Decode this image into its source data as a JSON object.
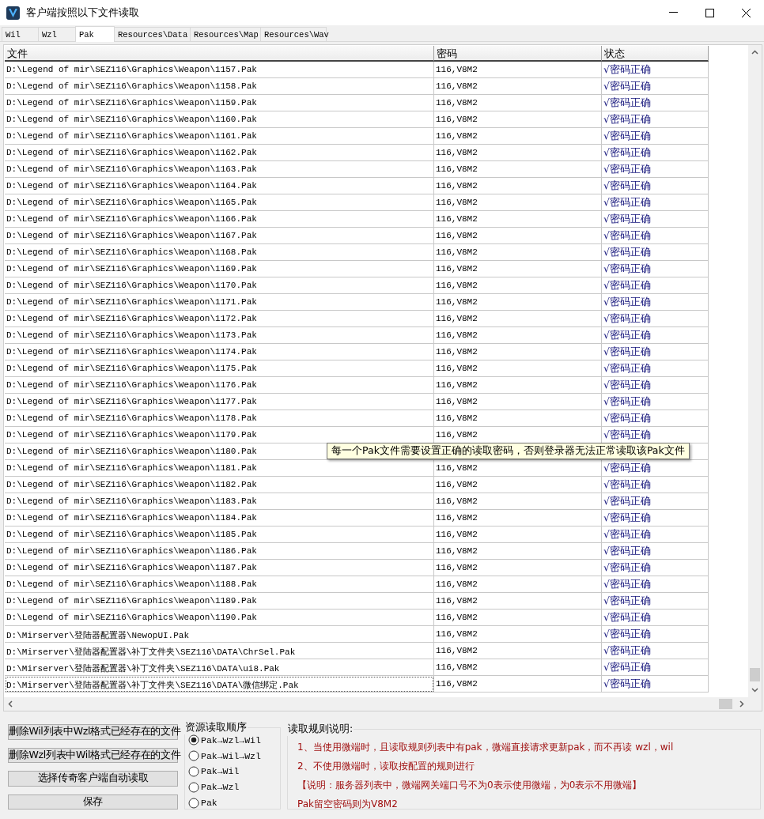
{
  "window": {
    "title": "客户端按照以下文件读取"
  },
  "tabs": [
    {
      "label": "Wil",
      "selected": false
    },
    {
      "label": "Wzl",
      "selected": false
    },
    {
      "label": "Pak",
      "selected": true
    },
    {
      "label": "Resources\\Data",
      "selected": false
    },
    {
      "label": "Resources\\Map",
      "selected": false
    },
    {
      "label": "Resources\\Wav",
      "selected": false
    }
  ],
  "table": {
    "columns": [
      "文件",
      "密码",
      "状态"
    ],
    "rows": [
      {
        "file": "D:\\Legend of mir\\SEZ116\\Graphics\\Weapon\\1157.Pak",
        "password": "116,V8M2",
        "status": "√密码正确",
        "selected": false
      },
      {
        "file": "D:\\Legend of mir\\SEZ116\\Graphics\\Weapon\\1158.Pak",
        "password": "116,V8M2",
        "status": "√密码正确",
        "selected": false
      },
      {
        "file": "D:\\Legend of mir\\SEZ116\\Graphics\\Weapon\\1159.Pak",
        "password": "116,V8M2",
        "status": "√密码正确",
        "selected": false
      },
      {
        "file": "D:\\Legend of mir\\SEZ116\\Graphics\\Weapon\\1160.Pak",
        "password": "116,V8M2",
        "status": "√密码正确",
        "selected": false
      },
      {
        "file": "D:\\Legend of mir\\SEZ116\\Graphics\\Weapon\\1161.Pak",
        "password": "116,V8M2",
        "status": "√密码正确",
        "selected": false
      },
      {
        "file": "D:\\Legend of mir\\SEZ116\\Graphics\\Weapon\\1162.Pak",
        "password": "116,V8M2",
        "status": "√密码正确",
        "selected": false
      },
      {
        "file": "D:\\Legend of mir\\SEZ116\\Graphics\\Weapon\\1163.Pak",
        "password": "116,V8M2",
        "status": "√密码正确",
        "selected": false
      },
      {
        "file": "D:\\Legend of mir\\SEZ116\\Graphics\\Weapon\\1164.Pak",
        "password": "116,V8M2",
        "status": "√密码正确",
        "selected": false
      },
      {
        "file": "D:\\Legend of mir\\SEZ116\\Graphics\\Weapon\\1165.Pak",
        "password": "116,V8M2",
        "status": "√密码正确",
        "selected": false
      },
      {
        "file": "D:\\Legend of mir\\SEZ116\\Graphics\\Weapon\\1166.Pak",
        "password": "116,V8M2",
        "status": "√密码正确",
        "selected": false
      },
      {
        "file": "D:\\Legend of mir\\SEZ116\\Graphics\\Weapon\\1167.Pak",
        "password": "116,V8M2",
        "status": "√密码正确",
        "selected": false
      },
      {
        "file": "D:\\Legend of mir\\SEZ116\\Graphics\\Weapon\\1168.Pak",
        "password": "116,V8M2",
        "status": "√密码正确",
        "selected": false
      },
      {
        "file": "D:\\Legend of mir\\SEZ116\\Graphics\\Weapon\\1169.Pak",
        "password": "116,V8M2",
        "status": "√密码正确",
        "selected": false
      },
      {
        "file": "D:\\Legend of mir\\SEZ116\\Graphics\\Weapon\\1170.Pak",
        "password": "116,V8M2",
        "status": "√密码正确",
        "selected": false
      },
      {
        "file": "D:\\Legend of mir\\SEZ116\\Graphics\\Weapon\\1171.Pak",
        "password": "116,V8M2",
        "status": "√密码正确",
        "selected": false
      },
      {
        "file": "D:\\Legend of mir\\SEZ116\\Graphics\\Weapon\\1172.Pak",
        "password": "116,V8M2",
        "status": "√密码正确",
        "selected": false
      },
      {
        "file": "D:\\Legend of mir\\SEZ116\\Graphics\\Weapon\\1173.Pak",
        "password": "116,V8M2",
        "status": "√密码正确",
        "selected": false
      },
      {
        "file": "D:\\Legend of mir\\SEZ116\\Graphics\\Weapon\\1174.Pak",
        "password": "116,V8M2",
        "status": "√密码正确",
        "selected": false
      },
      {
        "file": "D:\\Legend of mir\\SEZ116\\Graphics\\Weapon\\1175.Pak",
        "password": "116,V8M2",
        "status": "√密码正确",
        "selected": false
      },
      {
        "file": "D:\\Legend of mir\\SEZ116\\Graphics\\Weapon\\1176.Pak",
        "password": "116,V8M2",
        "status": "√密码正确",
        "selected": false
      },
      {
        "file": "D:\\Legend of mir\\SEZ116\\Graphics\\Weapon\\1177.Pak",
        "password": "116,V8M2",
        "status": "√密码正确",
        "selected": false
      },
      {
        "file": "D:\\Legend of mir\\SEZ116\\Graphics\\Weapon\\1178.Pak",
        "password": "116,V8M2",
        "status": "√密码正确",
        "selected": false
      },
      {
        "file": "D:\\Legend of mir\\SEZ116\\Graphics\\Weapon\\1179.Pak",
        "password": "116,V8M2",
        "status": "√密码正确",
        "selected": false
      },
      {
        "file": "D:\\Legend of mir\\SEZ116\\Graphics\\Weapon\\1180.Pak",
        "selected": false
      },
      {
        "file": "D:\\Legend of mir\\SEZ116\\Graphics\\Weapon\\1181.Pak",
        "password": "116,V8M2",
        "status": "√密码正确",
        "selected": false
      },
      {
        "file": "D:\\Legend of mir\\SEZ116\\Graphics\\Weapon\\1182.Pak",
        "password": "116,V8M2",
        "status": "√密码正确",
        "selected": false
      },
      {
        "file": "D:\\Legend of mir\\SEZ116\\Graphics\\Weapon\\1183.Pak",
        "password": "116,V8M2",
        "status": "√密码正确",
        "selected": false
      },
      {
        "file": "D:\\Legend of mir\\SEZ116\\Graphics\\Weapon\\1184.Pak",
        "password": "116,V8M2",
        "status": "√密码正确",
        "selected": false
      },
      {
        "file": "D:\\Legend of mir\\SEZ116\\Graphics\\Weapon\\1185.Pak",
        "password": "116,V8M2",
        "status": "√密码正确",
        "selected": false
      },
      {
        "file": "D:\\Legend of mir\\SEZ116\\Graphics\\Weapon\\1186.Pak",
        "password": "116,V8M2",
        "status": "√密码正确",
        "selected": false
      },
      {
        "file": "D:\\Legend of mir\\SEZ116\\Graphics\\Weapon\\1187.Pak",
        "password": "116,V8M2",
        "status": "√密码正确",
        "selected": false
      },
      {
        "file": "D:\\Legend of mir\\SEZ116\\Graphics\\Weapon\\1188.Pak",
        "password": "116,V8M2",
        "status": "√密码正确",
        "selected": false
      },
      {
        "file": "D:\\Legend of mir\\SEZ116\\Graphics\\Weapon\\1189.Pak",
        "password": "116,V8M2",
        "status": "√密码正确",
        "selected": false
      },
      {
        "file": "D:\\Legend of mir\\SEZ116\\Graphics\\Weapon\\1190.Pak",
        "password": "116,V8M2",
        "status": "√密码正确",
        "selected": false
      },
      {
        "file": "D:\\Mirserver\\登陆器配置器\\NewopUI.Pak",
        "password": "116,V8M2",
        "status": "√密码正确",
        "selected": false
      },
      {
        "file": "D:\\Mirserver\\登陆器配置器\\补丁文件夹\\SEZ116\\DATA\\ChrSel.Pak",
        "password": "116,V8M2",
        "status": "√密码正确",
        "selected": false
      },
      {
        "file": "D:\\Mirserver\\登陆器配置器\\补丁文件夹\\SEZ116\\DATA\\ui8.Pak",
        "password": "116,V8M2",
        "status": "√密码正确",
        "selected": false
      },
      {
        "file": "D:\\Mirserver\\登陆器配置器\\补丁文件夹\\SEZ116\\DATA\\微信绑定.Pak",
        "password": "116,V8M2",
        "status": "√密码正确",
        "selected": true
      }
    ],
    "tooltip": "每一个Pak文件需要设置正确的读取密码，否则登录器无法正常读取该Pak文件"
  },
  "buttons": [
    "删除Wil列表中Wzl格式已经存在的文件",
    "删除Wzl列表中Wil格式已经存在的文件",
    "选择传奇客户端自动读取",
    "保存"
  ],
  "read_order": {
    "title": "资源读取顺序",
    "options": [
      {
        "label": "Pak→Wzl→Wil",
        "selected": true
      },
      {
        "label": "Pak→Wil→Wzl",
        "selected": false
      },
      {
        "label": "Pak→Wil",
        "selected": false
      },
      {
        "label": "Pak→Wzl",
        "selected": false
      },
      {
        "label": "Pak",
        "selected": false
      }
    ]
  },
  "rules": {
    "title": "读取规则说明:",
    "lines": [
      "1、当使用微端时，且读取规则列表中有pak，微端直接请求更新pak，而不再读 wzl，wil",
      "2、不使用微端时，读取按配置的规则进行",
      "【说明：服务器列表中，微端网关端口号不为0表示使用微端，为0表示不用微端】",
      "Pak留空密码则为V8M2"
    ]
  }
}
